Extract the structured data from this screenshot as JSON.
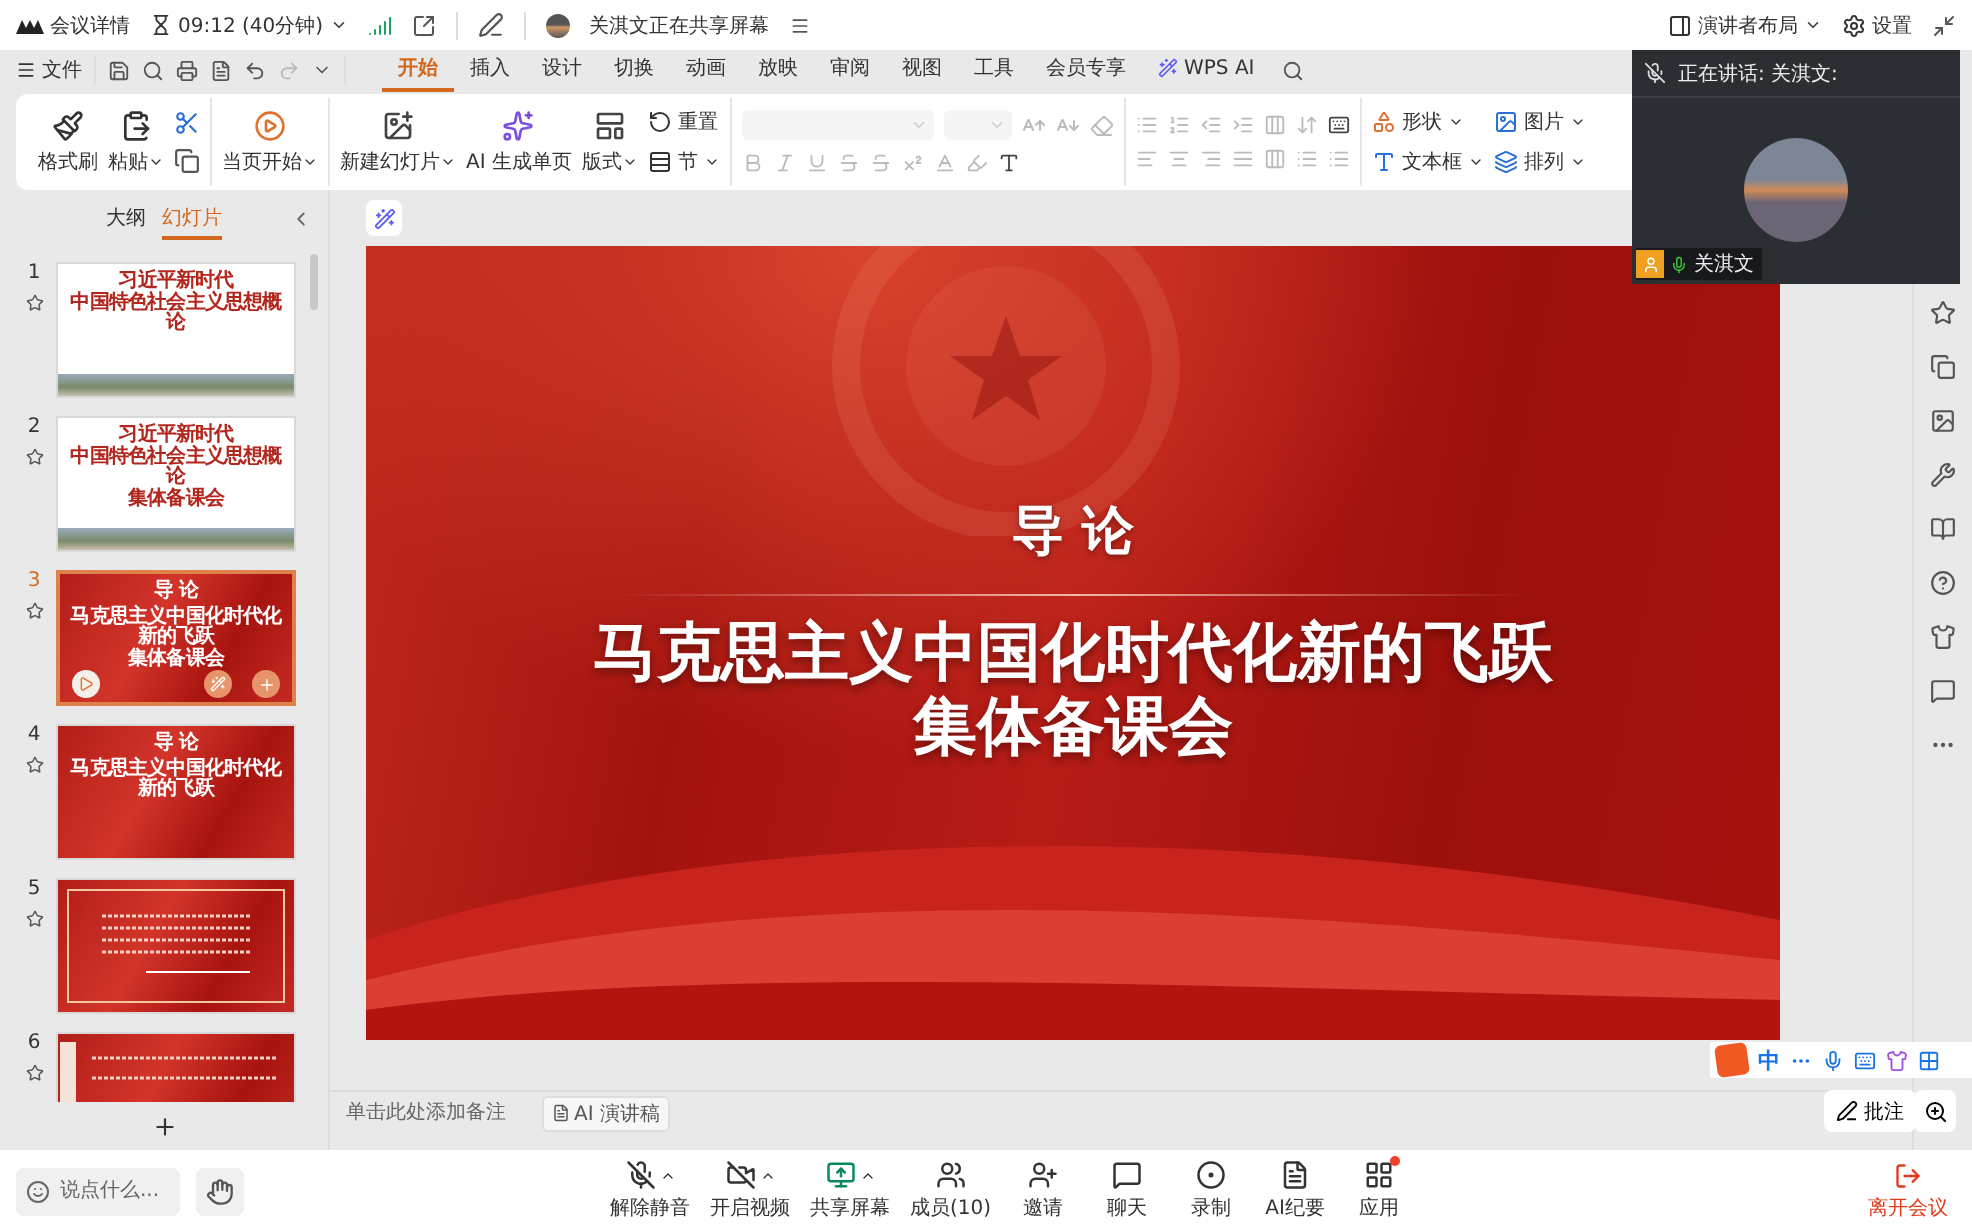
{
  "meeting_bar": {
    "details": "会议详情",
    "time": "09:12 (40分钟)",
    "sharing": "关淇文正在共享屏幕",
    "layout": "演讲者布局",
    "settings": "设置"
  },
  "menu": {
    "file": "文件"
  },
  "tabs": [
    {
      "label": "开始",
      "selected": true,
      "kind": "text"
    },
    {
      "label": "插入",
      "selected": false,
      "kind": "text"
    },
    {
      "label": "设计",
      "selected": false,
      "kind": "text"
    },
    {
      "label": "切换",
      "selected": false,
      "kind": "text"
    },
    {
      "label": "动画",
      "selected": false,
      "kind": "text"
    },
    {
      "label": "放映",
      "selected": false,
      "kind": "text"
    },
    {
      "label": "审阅",
      "selected": false,
      "kind": "text"
    },
    {
      "label": "视图",
      "selected": false,
      "kind": "text"
    },
    {
      "label": "工具",
      "selected": false,
      "kind": "text"
    },
    {
      "label": "会员专享",
      "selected": false,
      "kind": "text"
    },
    {
      "label": "WPS AI",
      "selected": false,
      "kind": "ai"
    }
  ],
  "ribbon": {
    "clipboard": [
      "格式刷",
      "粘贴"
    ],
    "play": "当页开始",
    "slides": [
      "新建幻灯片",
      "AI 生成单页",
      "版式"
    ],
    "slide_small": [
      "重置",
      "节"
    ],
    "insert": [
      "形状",
      "图片",
      "文本框",
      "排列"
    ]
  },
  "panel_tabs": [
    {
      "label": "大纲",
      "selected": false
    },
    {
      "label": "幻灯片",
      "selected": true
    }
  ],
  "slides": [
    {
      "number": "1",
      "selected": false,
      "kind": "light",
      "lines": [
        "习近平新时代",
        "中国特色社会主义思想概论"
      ]
    },
    {
      "number": "2",
      "selected": false,
      "kind": "light",
      "lines": [
        "习近平新时代",
        "中国特色社会主义思想概论",
        "集体备课会"
      ]
    },
    {
      "number": "3",
      "selected": true,
      "kind": "red",
      "lines": [
        "导 论",
        "马克思主义中国化时代化新的飞跃",
        "集体备课会"
      ]
    },
    {
      "number": "4",
      "selected": false,
      "kind": "red",
      "lines": [
        "导 论",
        "马克思主义中国化时代化新的飞跃"
      ]
    },
    {
      "number": "5",
      "selected": false,
      "kind": "framed"
    },
    {
      "number": "6",
      "selected": false,
      "kind": "list"
    }
  ],
  "slide": {
    "heading": "导 论",
    "title_lines": [
      "马克思主义中国化时代化新的飞跃",
      "集体备课会"
    ]
  },
  "notes": {
    "placeholder": "单击此处添加备注",
    "ai_button": "AI 演讲稿"
  },
  "video": {
    "status": "正在讲话:  关淇文:",
    "name": "关淇文"
  },
  "ime": {
    "mode": "中"
  },
  "annotate": "批注",
  "bottom": {
    "chat_placeholder": "说点什么...",
    "controls": [
      {
        "label": "解除静音",
        "kind": "mic-off",
        "menu": true,
        "badge": false
      },
      {
        "label": "开启视频",
        "kind": "video-off",
        "menu": true,
        "badge": false
      },
      {
        "label": "共享屏幕",
        "kind": "share",
        "menu": true,
        "badge": false
      },
      {
        "label": "成员(10)",
        "kind": "members",
        "menu": false,
        "badge": false
      },
      {
        "label": "邀请",
        "kind": "invite",
        "menu": false,
        "badge": false
      },
      {
        "label": "聊天",
        "kind": "chat",
        "menu": false,
        "badge": false
      },
      {
        "label": "录制",
        "kind": "record",
        "menu": false,
        "badge": false
      },
      {
        "label": "AI纪要",
        "kind": "notes",
        "menu": false,
        "badge": false
      },
      {
        "label": "应用",
        "kind": "apps",
        "menu": false,
        "badge": true
      }
    ],
    "leave": "离开会议"
  }
}
